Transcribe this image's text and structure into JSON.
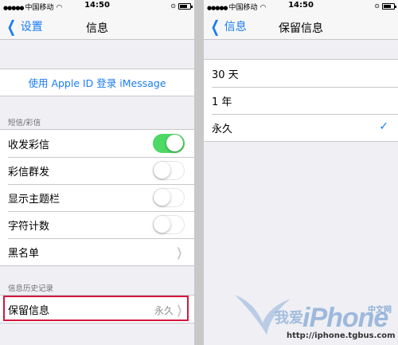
{
  "status_bar": {
    "carrier": "中国移动",
    "time": "14:50"
  },
  "left": {
    "nav": {
      "back_label": "设置",
      "title": "信息"
    },
    "apple_id_link": "使用 Apple ID 登录 iMessage",
    "sms_section": {
      "header": "短信/彩信",
      "items": [
        {
          "label": "收发彩信",
          "toggle": true
        },
        {
          "label": "彩信群发",
          "toggle": false
        },
        {
          "label": "显示主题栏",
          "toggle": false
        },
        {
          "label": "字符计数",
          "toggle": false
        }
      ],
      "blocked_label": "黑名单"
    },
    "history_section": {
      "header": "信息历史记录",
      "keep_messages_label": "保留信息",
      "keep_messages_value": "永久"
    }
  },
  "right": {
    "nav": {
      "back_label": "信息",
      "title": "保留信息"
    },
    "options": [
      {
        "label": "30 天",
        "selected": false
      },
      {
        "label": "1 年",
        "selected": false
      },
      {
        "label": "永久",
        "selected": true
      }
    ]
  },
  "watermark": {
    "brand": "iPhone",
    "zh_left": "我爱",
    "zh_right": "中文网",
    "url": "http://iphone.tgbus.com"
  },
  "colors": {
    "accent": "#1a7cf5",
    "toggle_on": "#4cd964",
    "highlight": "#d3183f",
    "background": "#efeff4"
  }
}
